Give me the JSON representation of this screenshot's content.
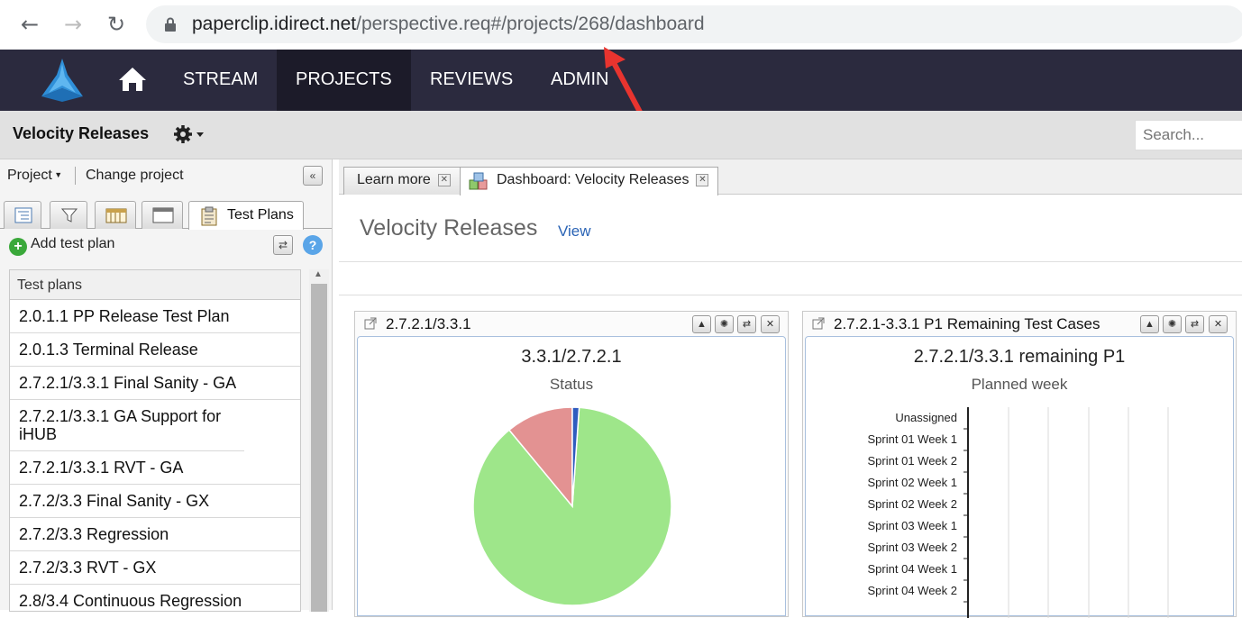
{
  "browser": {
    "url_host": "paperclip.idirect.net",
    "url_path": "/perspective.req#/projects/268/dashboard"
  },
  "nav": {
    "items": [
      {
        "label": "STREAM",
        "active": false
      },
      {
        "label": "PROJECTS",
        "active": true
      },
      {
        "label": "REVIEWS",
        "active": false
      },
      {
        "label": "ADMIN",
        "active": false
      }
    ]
  },
  "project_bar": {
    "name": "Velocity Releases",
    "search_placeholder": "Search..."
  },
  "left_panel": {
    "project_menu": "Project",
    "change_project": "Change project",
    "active_tab_label": "Test Plans",
    "add_label": "Add test plan",
    "help_label": "?",
    "grid_header": "Test plans",
    "rows": [
      "2.0.1.1 PP Release Test Plan",
      "2.0.1.3 Terminal Release",
      "2.7.2.1/3.3.1 Final Sanity - GA",
      "2.7.2.1/3.3.1 GA Support for iHUB",
      "2.7.2.1/3.3.1 RVT - GA",
      "2.7.2/3.3 Final Sanity - GX",
      "2.7.2/3.3 Regression",
      "2.7.2/3.3 RVT - GX",
      "2.8/3.4 Continuous Regression"
    ]
  },
  "content": {
    "tabs": [
      {
        "label": "Learn more"
      },
      {
        "label": "Dashboard: Velocity Releases"
      }
    ],
    "title": "Velocity Releases",
    "view_link": "View",
    "widgets": [
      {
        "title": "2.7.2.1/3.3.1",
        "chart_title": "3.3.1/2.7.2.1",
        "chart_subtitle": "Status"
      },
      {
        "title": "2.7.2.1-3.3.1 P1 Remaining Test Cases",
        "chart_title": "2.7.2.1/3.3.1 remaining P1",
        "chart_subtitle": "Planned week"
      }
    ]
  },
  "chart_data": [
    {
      "type": "pie",
      "title": "3.3.1/2.7.2.1",
      "subtitle": "Status",
      "series": [
        {
          "value": 87.9,
          "color": "#9ee68a"
        },
        {
          "value": 11.0,
          "color": "#e39292"
        },
        {
          "value": 1.1,
          "color": "#2f5cbf"
        }
      ]
    },
    {
      "type": "bar",
      "title": "2.7.2.1/3.3.1 remaining P1",
      "subtitle": "Planned week",
      "categories": [
        "Unassigned",
        "Sprint 01 Week 1",
        "Sprint 01 Week 2",
        "Sprint 02 Week 1",
        "Sprint 02 Week 2",
        "Sprint 03 Week 1",
        "Sprint 03 Week 2",
        "Sprint 04 Week 1",
        "Sprint 04 Week 2"
      ]
    }
  ],
  "colors": {
    "nav_bg": "#2b2a3e",
    "nav_active_bg": "#1c1b29",
    "link": "#2a63b5",
    "arrow": "#e8342f"
  }
}
